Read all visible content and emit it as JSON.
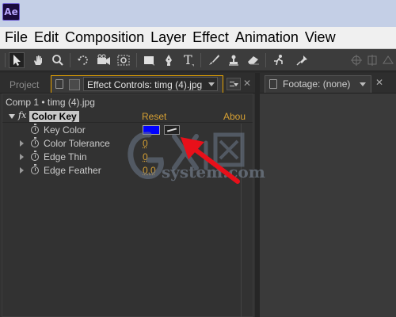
{
  "app": {
    "logo_text": "Ae",
    "accent_color": "#e8a400"
  },
  "menu": {
    "items": [
      "File",
      "Edit",
      "Composition",
      "Layer",
      "Effect",
      "Animation",
      "View"
    ]
  },
  "toolbar": {
    "tools": [
      "selection-tool-icon",
      "hand-tool-icon",
      "zoom-tool-icon",
      "rotate-tool-icon",
      "camera-tool-icon",
      "pan-behind-tool-icon",
      "rectangle-tool-icon",
      "pen-tool-icon",
      "text-tool-icon",
      "brush-tool-icon",
      "clone-stamp-tool-icon",
      "eraser-tool-icon",
      "roto-brush-tool-icon",
      "puppet-pin-tool-icon"
    ]
  },
  "left_panel": {
    "project_tab": "Project",
    "effect_controls_tab": "Effect Controls: timg (4).jpg",
    "comp_path": "Comp 1 • timg (4).jpg",
    "effect": {
      "fx_label": "fx",
      "name": "Color Key",
      "reset_label": "Reset",
      "about_label": "Abou"
    },
    "properties": [
      {
        "label": "Key Color",
        "value": "",
        "color": "#0000ff"
      },
      {
        "label": "Color Tolerance",
        "value": "0"
      },
      {
        "label": "Edge Thin",
        "value": "0"
      },
      {
        "label": "Edge Feather",
        "value": "0.0"
      }
    ]
  },
  "right_panel": {
    "footage_tab": "Footage: (none)"
  },
  "watermark": {
    "text": "system.com",
    "mark": "GXI网"
  }
}
